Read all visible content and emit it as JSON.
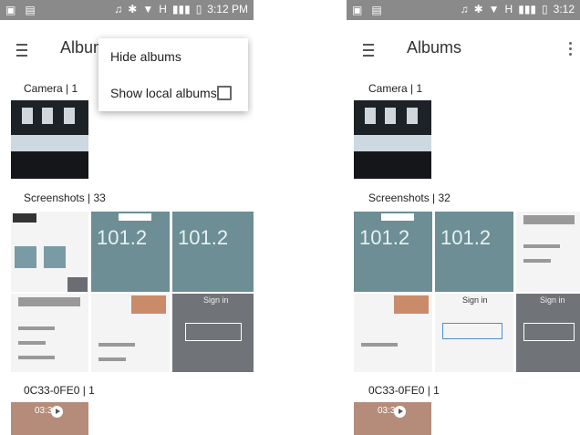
{
  "left": {
    "status": {
      "time": "3:12 PM",
      "network": "H"
    },
    "title": "Albums",
    "menu": {
      "hide_albums": "Hide albums",
      "show_local_albums": "Show local albums"
    },
    "sections": [
      {
        "label": "Camera | 1"
      },
      {
        "label": "Screenshots | 33"
      },
      {
        "label": "0C33-0FE0 | 1"
      }
    ],
    "tiles": {
      "radio_value_1": "101.2",
      "radio_value_2": "101.2",
      "signin": "Sign in",
      "video_time": "03:33"
    }
  },
  "right": {
    "status": {
      "time": "3:12",
      "network": "H"
    },
    "title": "Albums",
    "sections": [
      {
        "label": "Camera | 1"
      },
      {
        "label": "Screenshots | 32"
      },
      {
        "label": "0C33-0FE0 | 1"
      }
    ],
    "tiles": {
      "radio_value_1": "101.2",
      "radio_value_2": "101.2",
      "signin": "Sign in",
      "video_time": "03:33"
    }
  },
  "icons": {
    "menu": "hamburger-menu-icon",
    "overflow": "overflow-menu-icon",
    "play": "play-icon"
  }
}
